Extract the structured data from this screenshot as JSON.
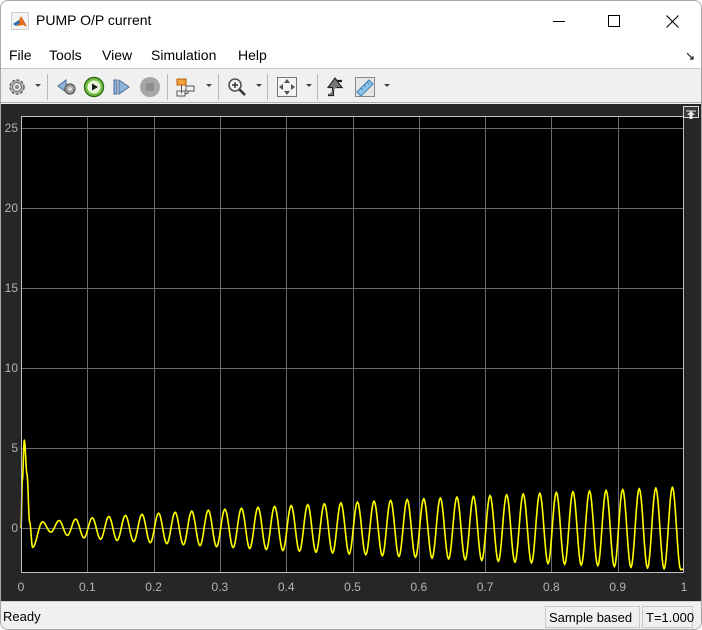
{
  "window": {
    "title": "PUMP O/P current",
    "controls": {
      "minimize": "minimize",
      "maximize": "maximize",
      "close": "close"
    }
  },
  "menu": {
    "items": [
      "File",
      "Tools",
      "View",
      "Simulation",
      "Help"
    ]
  },
  "toolbar": {
    "buttons": [
      {
        "name": "configuration-properties",
        "icon": "gear-icon",
        "dropdown": true
      },
      {
        "name": "step-back",
        "icon": "step-back-icon",
        "dropdown": false
      },
      {
        "name": "run",
        "icon": "play-icon",
        "dropdown": false
      },
      {
        "name": "step-forward",
        "icon": "step-forward-icon",
        "dropdown": false
      },
      {
        "name": "stop",
        "icon": "stop-icon",
        "dropdown": false,
        "disabled": true
      },
      {
        "name": "highlight-simulink-block",
        "icon": "block-diagram-icon",
        "dropdown": true
      },
      {
        "name": "zoom-in",
        "icon": "zoom-in-icon",
        "dropdown": true
      },
      {
        "name": "scale-axes",
        "icon": "fit-to-view-icon",
        "dropdown": true
      },
      {
        "name": "triggers",
        "icon": "trigger-icon",
        "dropdown": false
      },
      {
        "name": "measurements",
        "icon": "ruler-icon",
        "dropdown": true
      }
    ]
  },
  "status": {
    "text": "Ready",
    "mode": "Sample based",
    "time": "T=1.000"
  },
  "colors": {
    "plot_background": "#000000",
    "panel_background": "#262626",
    "line": "#ffff00",
    "grid": "#6a6a6a",
    "axes_border": "#c0c0c0",
    "tick_label": "#b4b4b4"
  },
  "chart_data": {
    "type": "line",
    "title": "",
    "xlabel": "",
    "ylabel": "",
    "xlim": [
      0,
      1
    ],
    "ylim": [
      -2.8,
      25.75
    ],
    "grid": true,
    "legend": "none",
    "x_ticks": [
      0,
      0.1,
      0.2,
      0.3,
      0.4,
      0.5,
      0.6,
      0.7,
      0.8,
      0.9,
      1
    ],
    "x_tick_labels": [
      "0",
      "0.1",
      "0.2",
      "0.3",
      "0.4",
      "0.5",
      "0.6",
      "0.7",
      "0.8",
      "0.9",
      "1"
    ],
    "y_ticks": [
      0,
      5,
      10,
      15,
      20,
      25
    ],
    "y_tick_labels": [
      "0",
      "5",
      "10",
      "15",
      "20",
      "25"
    ],
    "series": [
      {
        "name": "PUMP O/P current",
        "note": "approx. 40 Hz oscillation with growing envelope; points are initial transient then alternating local extrema",
        "x": [
          0,
          0.002,
          0.005,
          0.009,
          0.013,
          0.0175,
          0.0325,
          0.045,
          0.0575,
          0.07,
          0.0825,
          0.095,
          0.1075,
          0.12,
          0.1325,
          0.145,
          0.1575,
          0.17,
          0.1825,
          0.195,
          0.2075,
          0.22,
          0.2325,
          0.245,
          0.2575,
          0.27,
          0.2825,
          0.295,
          0.3075,
          0.32,
          0.3325,
          0.345,
          0.3575,
          0.37,
          0.3825,
          0.395,
          0.4075,
          0.42,
          0.4325,
          0.445,
          0.4575,
          0.47,
          0.4825,
          0.495,
          0.5075,
          0.52,
          0.5325,
          0.545,
          0.5575,
          0.57,
          0.5825,
          0.595,
          0.6075,
          0.62,
          0.6325,
          0.645,
          0.6575,
          0.67,
          0.6825,
          0.695,
          0.7075,
          0.72,
          0.7325,
          0.745,
          0.7575,
          0.77,
          0.7825,
          0.795,
          0.8075,
          0.82,
          0.8325,
          0.845,
          0.8575,
          0.87,
          0.8825,
          0.895,
          0.9075,
          0.92,
          0.9325,
          0.945,
          0.9575,
          0.97,
          0.9825,
          0.995,
          1.0
        ],
        "y": [
          0,
          3.0,
          5.5,
          3.4,
          0.4,
          -1.2,
          0.4,
          -0.25,
          0.48,
          -0.45,
          0.57,
          -0.61,
          0.65,
          -0.69,
          0.73,
          -0.77,
          0.8,
          -0.84,
          0.87,
          -0.91,
          0.94,
          -0.97,
          1.0,
          -1.04,
          1.07,
          -1.1,
          1.13,
          -1.16,
          1.19,
          -1.22,
          1.25,
          -1.28,
          1.31,
          -1.34,
          1.37,
          -1.4,
          1.42,
          -1.45,
          1.48,
          -1.51,
          1.53,
          -1.56,
          1.59,
          -1.62,
          1.64,
          -1.67,
          1.7,
          -1.73,
          1.75,
          -1.78,
          1.8,
          -1.83,
          1.85,
          -1.88,
          1.9,
          -1.93,
          1.95,
          -1.98,
          2.0,
          -2.03,
          2.05,
          -2.08,
          2.1,
          -2.13,
          2.15,
          -2.18,
          2.2,
          -2.23,
          2.25,
          -2.27,
          2.29,
          -2.32,
          2.34,
          -2.36,
          2.38,
          -2.41,
          2.43,
          -2.46,
          2.48,
          -2.5,
          2.52,
          -2.55,
          2.57,
          -2.59,
          -2.55
        ]
      }
    ]
  }
}
